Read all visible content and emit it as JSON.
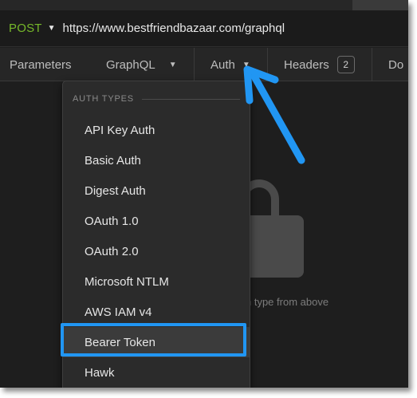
{
  "request": {
    "method": "POST",
    "url": "https://www.bestfriendbazaar.com/graphql"
  },
  "tabs": [
    {
      "label": "Parameters"
    },
    {
      "label": "GraphQL"
    },
    {
      "label": "Auth"
    },
    {
      "label": "Headers",
      "badge": "2"
    },
    {
      "label": "Do"
    }
  ],
  "content": {
    "hint": "n type from above"
  },
  "dropdown": {
    "header": "AUTH TYPES",
    "items": [
      {
        "label": "API Key Auth"
      },
      {
        "label": "Basic Auth"
      },
      {
        "label": "Digest Auth"
      },
      {
        "label": "OAuth 1.0"
      },
      {
        "label": "OAuth 2.0"
      },
      {
        "label": "Microsoft NTLM"
      },
      {
        "label": "AWS IAM v4"
      },
      {
        "label": "Bearer Token"
      },
      {
        "label": "Hawk"
      }
    ]
  },
  "colors": {
    "method": "#76b82a",
    "annotation": "#2196f3",
    "background": "#1e1e1e"
  },
  "icons": {
    "lock": "lock-icon",
    "caret": "caret-down-icon"
  }
}
